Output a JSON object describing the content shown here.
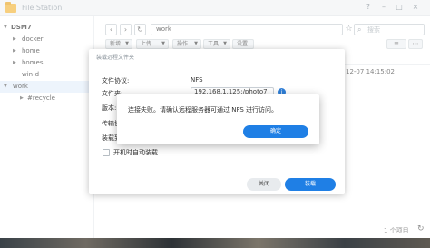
{
  "app": {
    "title": "File Station",
    "controls": {
      "help": "?",
      "minimize": "–",
      "maximize": "□",
      "close": "×"
    }
  },
  "sidebar": {
    "root": "DSM7",
    "items": [
      {
        "label": "docker"
      },
      {
        "label": "home"
      },
      {
        "label": "homes"
      },
      {
        "label": "win-d"
      },
      {
        "label": "work",
        "selected": true
      },
      {
        "label": "#recycle"
      }
    ]
  },
  "toolbar": {
    "back": "‹",
    "forward": "›",
    "refresh": "↻",
    "path": "work",
    "star": "☆",
    "search_icon": "⌕",
    "search_placeholder": "搜索",
    "buttons": [
      "新增",
      "上传",
      "操作",
      "工具",
      "设置"
    ],
    "view_list": "≡",
    "view_more": "⋯"
  },
  "list": {
    "date": "12-07 14:15:02",
    "count": "1 个项目",
    "refresh": "↻"
  },
  "mount_dialog": {
    "title": "装载远程文件夹",
    "fields": [
      {
        "label": "文件协议:",
        "value": "NFS"
      },
      {
        "label": "文件夹:",
        "value": "192.168.1.125:/photo7"
      },
      {
        "label": "版本:"
      },
      {
        "label": "传输协议:"
      },
      {
        "label": "装载到:"
      }
    ],
    "auto_mount": "开机时自动装载",
    "info": "i",
    "close_button": "关闭",
    "mount_button": "装载"
  },
  "alert": {
    "message": "连接失败。请确认远程服务器可通过 NFS 进行访问。",
    "ok_button": "确定"
  },
  "colors": {
    "accent": "#1f7fe5",
    "folder": "#f3b63a",
    "selected_row": "#e4eefb"
  }
}
